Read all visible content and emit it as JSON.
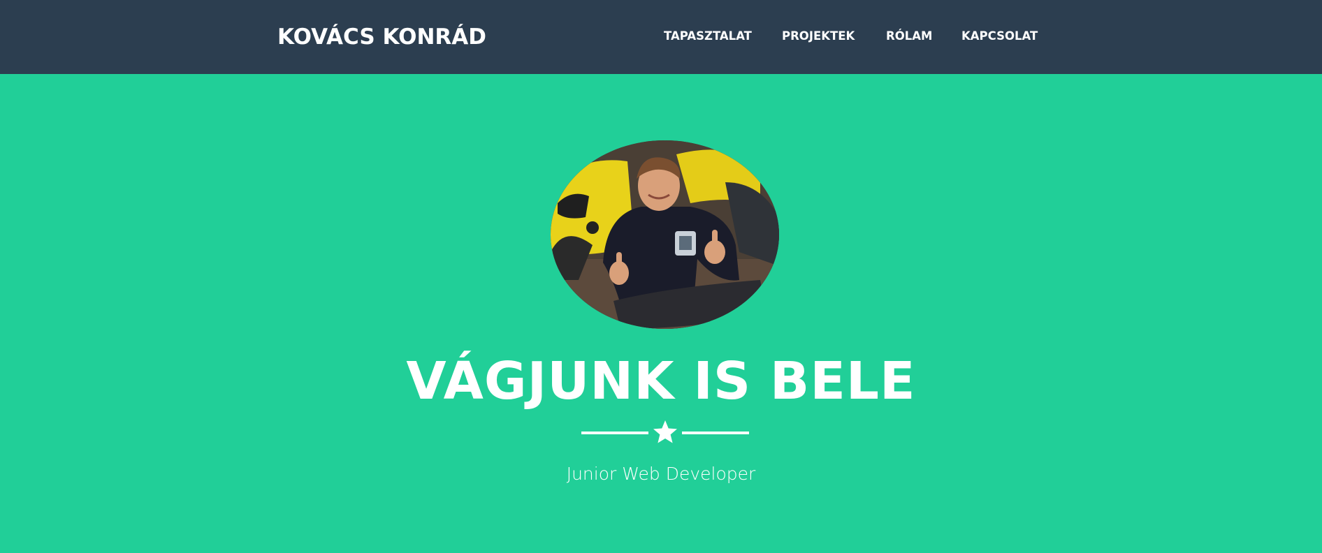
{
  "navbar": {
    "brand": "KOVÁCS KONRÁD",
    "links": [
      {
        "label": "TAPASZTALAT"
      },
      {
        "label": "PROJEKTEK"
      },
      {
        "label": "RÓLAM"
      },
      {
        "label": "KAPCSOLAT"
      }
    ]
  },
  "hero": {
    "headline": "VÁGJUNK IS BELE",
    "divider_icon": "star-icon",
    "subtitle": "Junior Web Developer",
    "avatar_alt": "profile-photo"
  },
  "colors": {
    "navbar_bg": "#2c3e50",
    "hero_bg": "#21cf98",
    "text": "#ffffff"
  }
}
